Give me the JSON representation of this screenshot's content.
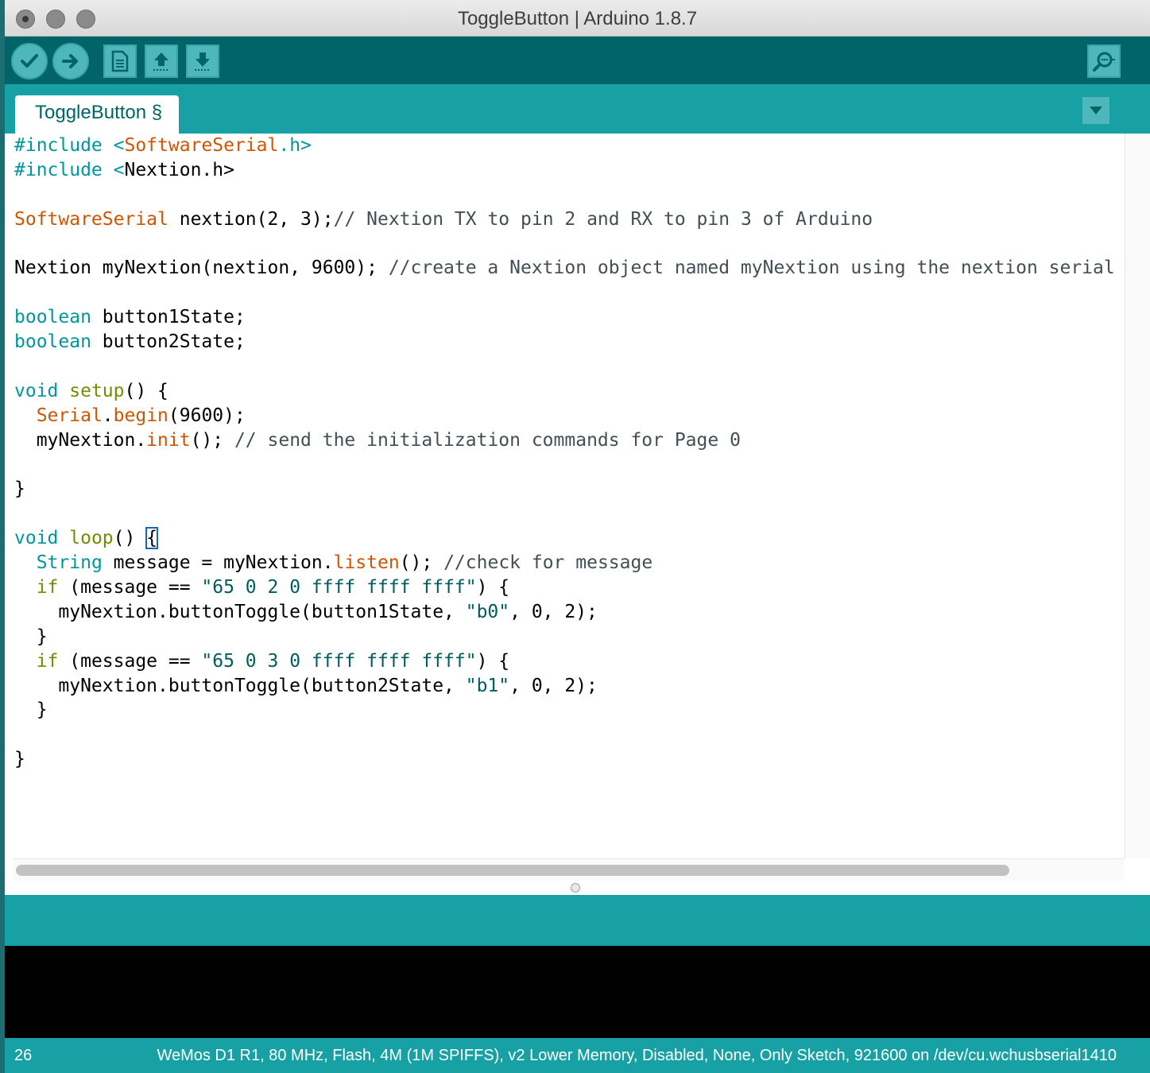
{
  "window": {
    "title": "ToggleButton | Arduino 1.8.7"
  },
  "toolbar": {
    "buttons": [
      {
        "name": "verify",
        "icon": "checkmark-icon"
      },
      {
        "name": "upload",
        "icon": "arrow-right-icon"
      },
      {
        "name": "new",
        "icon": "new-file-icon"
      },
      {
        "name": "open",
        "icon": "arrow-up-icon"
      },
      {
        "name": "save",
        "icon": "arrow-down-icon"
      },
      {
        "name": "serial-monitor",
        "icon": "magnifier-icon"
      }
    ]
  },
  "tabs": [
    {
      "label": "ToggleButton §",
      "active": true
    }
  ],
  "editor": {
    "lines": [
      [
        {
          "t": "#include <",
          "c": "kw"
        },
        {
          "t": "SoftwareSerial",
          "c": "tp"
        },
        {
          "t": ".h>",
          "c": "kw"
        }
      ],
      [
        {
          "t": "#include <",
          "c": "kw"
        },
        {
          "t": "Nextion.h>",
          "c": ""
        }
      ],
      [],
      [
        {
          "t": "SoftwareSerial",
          "c": "tp"
        },
        {
          "t": " nextion(2, 3);",
          "c": ""
        },
        {
          "t": "// Nextion TX to pin 2 and RX to pin 3 of Arduino",
          "c": "cm"
        }
      ],
      [],
      [
        {
          "t": "Nextion myNextion(nextion, 9600); ",
          "c": ""
        },
        {
          "t": "//create a Nextion object named myNextion using the nextion serial por",
          "c": "cm"
        }
      ],
      [],
      [
        {
          "t": "boolean",
          "c": "kw"
        },
        {
          "t": " button1State;",
          "c": ""
        }
      ],
      [
        {
          "t": "boolean",
          "c": "kw"
        },
        {
          "t": " button2State;",
          "c": ""
        }
      ],
      [],
      [
        {
          "t": "void",
          "c": "kw"
        },
        {
          "t": " ",
          "c": ""
        },
        {
          "t": "setup",
          "c": "ctl"
        },
        {
          "t": "() {",
          "c": ""
        }
      ],
      [
        {
          "t": "  ",
          "c": ""
        },
        {
          "t": "Serial",
          "c": "fn"
        },
        {
          "t": ".",
          "c": ""
        },
        {
          "t": "begin",
          "c": "fn"
        },
        {
          "t": "(9600);",
          "c": ""
        }
      ],
      [
        {
          "t": "  myNextion.",
          "c": ""
        },
        {
          "t": "init",
          "c": "fn"
        },
        {
          "t": "(); ",
          "c": ""
        },
        {
          "t": "// send the initialization commands for Page 0",
          "c": "cm"
        }
      ],
      [],
      [
        {
          "t": "}",
          "c": ""
        }
      ],
      [],
      [
        {
          "t": "void",
          "c": "kw"
        },
        {
          "t": " ",
          "c": ""
        },
        {
          "t": "loop",
          "c": "ctl"
        },
        {
          "t": "() ",
          "c": ""
        },
        {
          "t": "{",
          "c": "caret"
        }
      ],
      [
        {
          "t": "  ",
          "c": ""
        },
        {
          "t": "String",
          "c": "kw"
        },
        {
          "t": " message = myNextion.",
          "c": ""
        },
        {
          "t": "listen",
          "c": "fn"
        },
        {
          "t": "(); ",
          "c": ""
        },
        {
          "t": "//check for message",
          "c": "cm"
        }
      ],
      [
        {
          "t": "  ",
          "c": ""
        },
        {
          "t": "if",
          "c": "ctl"
        },
        {
          "t": " (message == ",
          "c": ""
        },
        {
          "t": "\"65 0 2 0 ffff ffff ffff\"",
          "c": "st"
        },
        {
          "t": ") {",
          "c": ""
        }
      ],
      [
        {
          "t": "    myNextion.buttonToggle(button1State, ",
          "c": ""
        },
        {
          "t": "\"b0\"",
          "c": "st"
        },
        {
          "t": ", 0, 2);",
          "c": ""
        }
      ],
      [
        {
          "t": "  }",
          "c": ""
        }
      ],
      [
        {
          "t": "  ",
          "c": ""
        },
        {
          "t": "if",
          "c": "ctl"
        },
        {
          "t": " (message == ",
          "c": ""
        },
        {
          "t": "\"65 0 3 0 ffff ffff ffff\"",
          "c": "st"
        },
        {
          "t": ") {",
          "c": ""
        }
      ],
      [
        {
          "t": "    myNextion.buttonToggle(button2State, ",
          "c": ""
        },
        {
          "t": "\"b1\"",
          "c": "st"
        },
        {
          "t": ", 0, 2);",
          "c": ""
        }
      ],
      [
        {
          "t": "  }",
          "c": ""
        }
      ],
      [],
      [
        {
          "t": "}",
          "c": ""
        }
      ]
    ]
  },
  "status": {
    "line_number": "26",
    "board": "WeMos D1 R1, 80 MHz, Flash, 4M (1M SPIFFS), v2 Lower Memory, Disabled, None, Only Sketch, 921600 on /dev/cu.wchusbserial1410"
  },
  "colors": {
    "toolbar": "#006468",
    "tabstrip": "#17a1a5",
    "button": "#4db7bb",
    "keyword": "#00979c",
    "type": "#d35400",
    "comment": "#434f54"
  }
}
